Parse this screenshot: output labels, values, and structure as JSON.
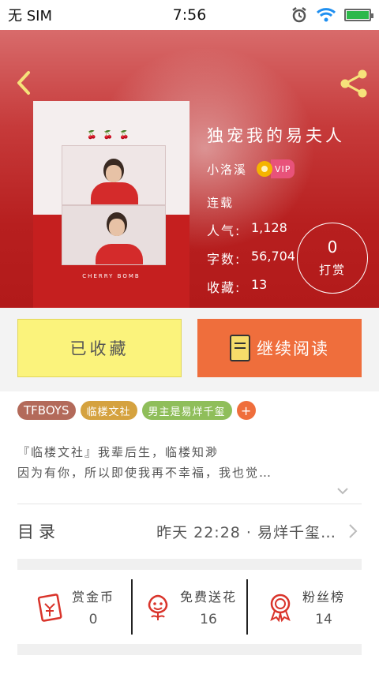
{
  "status_bar": {
    "carrier": "无 SIM",
    "time": "7:56"
  },
  "book": {
    "title": "独宠我的易夫人",
    "author": "小洛溪",
    "vip_label": "VIP",
    "status": "连载",
    "stats": [
      {
        "label": "人气:",
        "value": "1,128"
      },
      {
        "label": "字数:",
        "value": "56,704"
      },
      {
        "label": "收藏:",
        "value": "13"
      }
    ],
    "cover_text": "CHERRY BOMB"
  },
  "tip": {
    "count": "0",
    "label": "打赏"
  },
  "actions": {
    "favorite_label": "已收藏",
    "read_label": "继续阅读"
  },
  "tags": [
    "TFBOYS",
    "临楼文社",
    "男主是易烊千玺"
  ],
  "tag_add": "+",
  "description": {
    "line1": "『临楼文社』我辈后生，临楼知渺",
    "line2": "因为有你，所以即使我再不幸福，我也觉…"
  },
  "catalog": {
    "label": "目录",
    "latest": "昨天 22:28 · 易烊千玺…"
  },
  "bottom_stats": [
    {
      "label": "赏金币",
      "value": "0",
      "icon": "red-envelope-icon"
    },
    {
      "label": "免费送花",
      "value": "16",
      "icon": "flower-icon"
    },
    {
      "label": "粉丝榜",
      "value": "14",
      "icon": "medal-icon"
    }
  ],
  "colors": {
    "header_red": "#b71f1f",
    "fav_yellow": "#fbf37c",
    "read_orange": "#ef6e3c",
    "icon_red": "#d9342b"
  }
}
